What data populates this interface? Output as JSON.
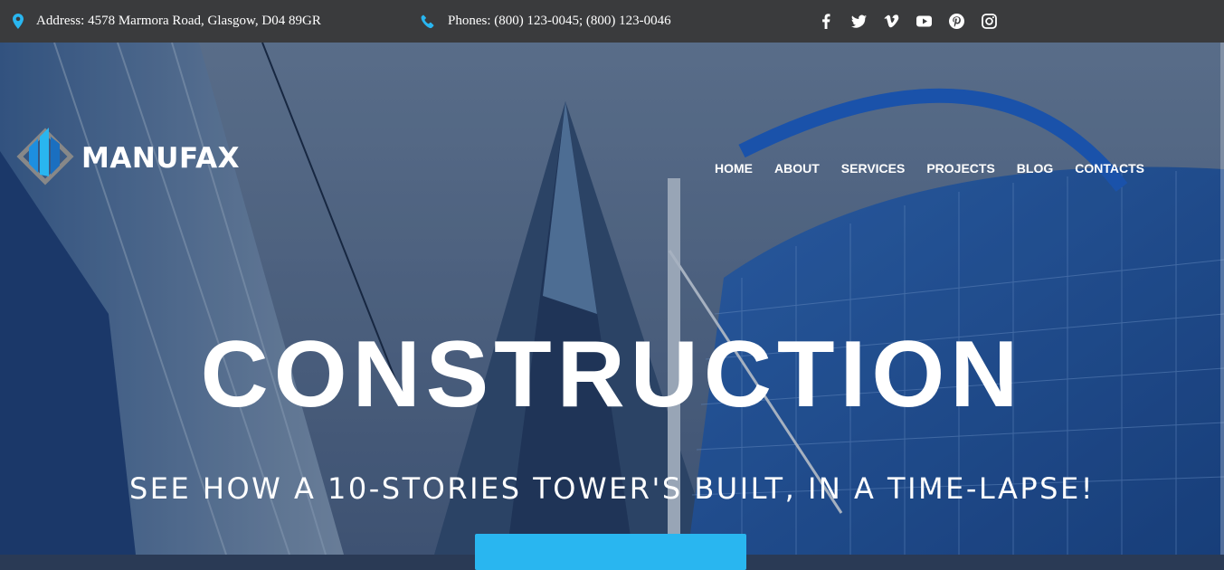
{
  "topbar": {
    "address": "Address: 4578 Marmora Road, Glasgow, D04 89GR",
    "phones": "Phones: (800) 123-0045; (800) 123-0046",
    "socials": [
      "facebook-icon",
      "twitter-icon",
      "vimeo-icon",
      "youtube-icon",
      "pinterest-icon",
      "instagram-icon"
    ]
  },
  "brand": {
    "name": "MANUFAX"
  },
  "nav": {
    "items": [
      "HOME",
      "ABOUT",
      "SERVICES",
      "PROJECTS",
      "BLOG",
      "CONTACTS"
    ]
  },
  "hero": {
    "title": "CONSTRUCTION",
    "subtitle": "SEE HOW A 10-STORIES TOWER'S BUILT, IN A TIME-LAPSE!"
  },
  "colors": {
    "accent": "#29b6f0",
    "topbar": "#3a3b3d"
  }
}
